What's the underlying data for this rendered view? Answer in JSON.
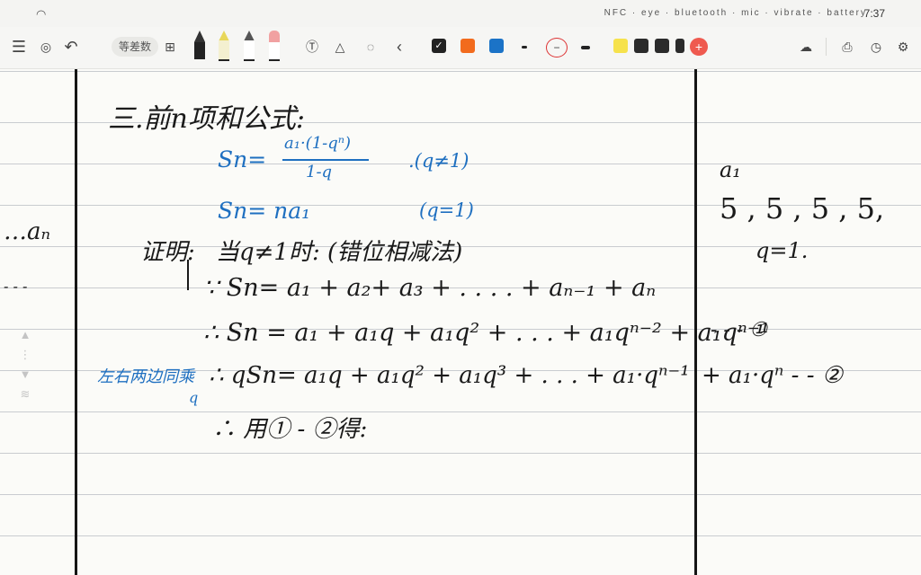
{
  "status": {
    "time": "7:37",
    "wifi_icon": "wifi-icon",
    "status_icons": "NFC · eye · bluetooth · mic · vibrate · battery"
  },
  "toolbar": {
    "template_label": "等差数",
    "colors": [
      "#222222",
      "#f26b1d",
      "#1b73c7"
    ],
    "highlight_colors": [
      "#f6e24c",
      "#2b2b2b",
      "#2b2b2b",
      "#2b2b2b"
    ],
    "add_color_symbol": "+"
  },
  "note": {
    "heading": "三.前n项和公式:",
    "formula1_lhs": "Sn=",
    "formula1_num": "a₁·(1-qⁿ)",
    "formula1_den": "1-q",
    "formula1_cond": ".(q≠1)",
    "formula2": "Sn= na₁",
    "formula2_cond": "(q=1)",
    "left_margin_text": "…aₙ",
    "left_margin_text2": "- - -",
    "proof_label": "证明:",
    "proof_case": "当q≠1时: (错位相减法)",
    "line1": "∵ Sn= a₁ + a₂+ a₃ +   . . . . + aₙ₋₁ + aₙ",
    "line2": "∴ Sn = a₁ + a₁q + a₁q² +   . . . + a₁qⁿ⁻² + a₁qⁿ⁻¹",
    "line2_mark": "- - - ①",
    "side_note": "左右两边同乘",
    "side_note2": "q",
    "line3": "∴ qSn=      a₁q  + a₁q² + a₁q³ +   . . . + a₁·qⁿ⁻¹",
    "line3_tail": "+ a₁·qⁿ - - ②",
    "line4": "∴ 用① - ②得:",
    "right_a1": "a₁",
    "right_seq": "5  , 5  , 5 , 5,",
    "right_q": "q=1."
  }
}
